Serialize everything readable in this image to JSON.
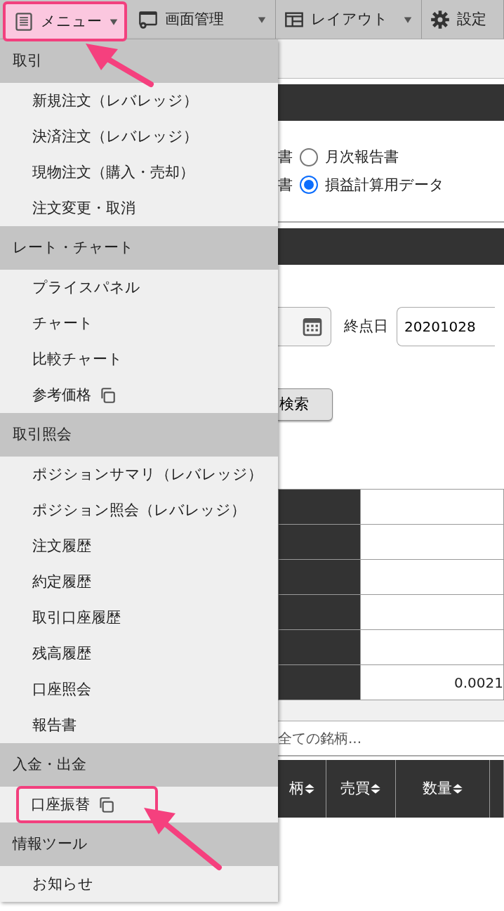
{
  "toolbar": {
    "buttons": [
      {
        "label": "メニュー",
        "kind": "menu",
        "caret": true,
        "highlighted": true
      },
      {
        "label": "画面管理",
        "kind": "screen",
        "caret": true,
        "highlighted": false
      },
      {
        "label": "レイアウト",
        "kind": "layout",
        "caret": true,
        "highlighted": false
      },
      {
        "label": "設定",
        "kind": "settings",
        "caret": false,
        "highlighted": false
      }
    ]
  },
  "menu": {
    "sections": [
      {
        "title": "取引",
        "items": [
          {
            "label": "新規注文（レバレッジ）",
            "external": false,
            "highlighted": false
          },
          {
            "label": "決済注文（レバレッジ）",
            "external": false,
            "highlighted": false
          },
          {
            "label": "現物注文（購入・売却）",
            "external": false,
            "highlighted": false
          },
          {
            "label": "注文変更・取消",
            "external": false,
            "highlighted": false
          }
        ]
      },
      {
        "title": "レート・チャート",
        "items": [
          {
            "label": "プライスパネル",
            "external": false,
            "highlighted": false
          },
          {
            "label": "チャート",
            "external": false,
            "highlighted": false
          },
          {
            "label": "比較チャート",
            "external": false,
            "highlighted": false
          },
          {
            "label": "参考価格",
            "external": true,
            "highlighted": false
          }
        ]
      },
      {
        "title": "取引照会",
        "items": [
          {
            "label": "ポジションサマリ（レバレッジ）",
            "external": false,
            "highlighted": false
          },
          {
            "label": "ポジション照会（レバレッジ）",
            "external": false,
            "highlighted": false
          },
          {
            "label": "注文履歴",
            "external": false,
            "highlighted": false
          },
          {
            "label": "約定履歴",
            "external": false,
            "highlighted": false
          },
          {
            "label": "取引口座履歴",
            "external": false,
            "highlighted": false
          },
          {
            "label": "残高履歴",
            "external": false,
            "highlighted": false
          },
          {
            "label": "口座照会",
            "external": false,
            "highlighted": false
          },
          {
            "label": "報告書",
            "external": false,
            "highlighted": false
          }
        ]
      },
      {
        "title": "入金・出金",
        "items": [
          {
            "label": "口座振替",
            "external": true,
            "highlighted": true
          }
        ]
      },
      {
        "title": "情報ツール",
        "items": [
          {
            "label": "お知らせ",
            "external": false,
            "highlighted": false
          }
        ]
      }
    ]
  },
  "report_types": [
    {
      "prefix": "書",
      "label": "月次報告書",
      "selected": false
    },
    {
      "prefix": "書",
      "label": "損益計算用データ",
      "selected": true
    }
  ],
  "period": {
    "end_label": "終点日",
    "end_value": "20201028"
  },
  "search_button": "検索",
  "summary_rows": [
    {},
    {},
    {},
    {},
    {},
    {
      "value": "0.0021"
    }
  ],
  "filter": {
    "placeholder": "全ての銘柄..."
  },
  "columns": [
    {
      "label": "柄",
      "sortable": true
    },
    {
      "label": "売買",
      "sortable": true
    },
    {
      "label": "数量",
      "sortable": true
    }
  ]
}
